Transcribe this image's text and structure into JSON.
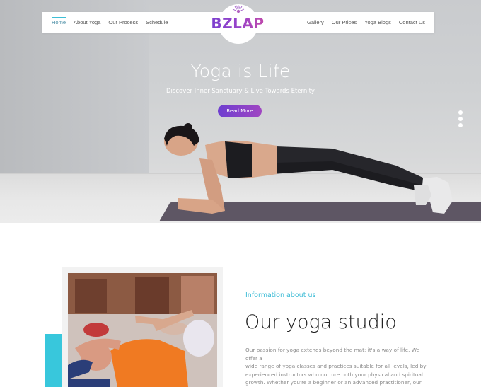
{
  "nav": {
    "left": [
      "Home",
      "About Yoga",
      "Our Process",
      "Schedule"
    ],
    "right": [
      "Gallery",
      "Our Prices",
      "Yoga Blogs",
      "Contact Us"
    ],
    "active": "Home"
  },
  "logo": {
    "text": "BZLAP",
    "icon": "sun-icon",
    "gradient": [
      "#7a3fcf",
      "#c24aa9"
    ]
  },
  "hero": {
    "title": "Yoga is Life",
    "subtitle": "Discover Inner Sanctuary & Live Towards Eternity",
    "button": "Read More",
    "slides": 3
  },
  "about": {
    "label": "Information about us",
    "title": "Our yoga studio",
    "body": "Our passion for yoga extends beyond the mat; it's a way of life. We offer a\nwide range of yoga classes and practices suitable for all levels, led by\nexperienced instructors who nurture both your physical and spiritual\ngrowth. Whether you're a beginner or an advanced practitioner, our virtual\nstudio is a welcoming space for you to explore mindfulness, find inner"
  },
  "colors": {
    "accent": "#3ebcd6",
    "button": "#8a43c8",
    "teal_block": "#38c7dc"
  }
}
